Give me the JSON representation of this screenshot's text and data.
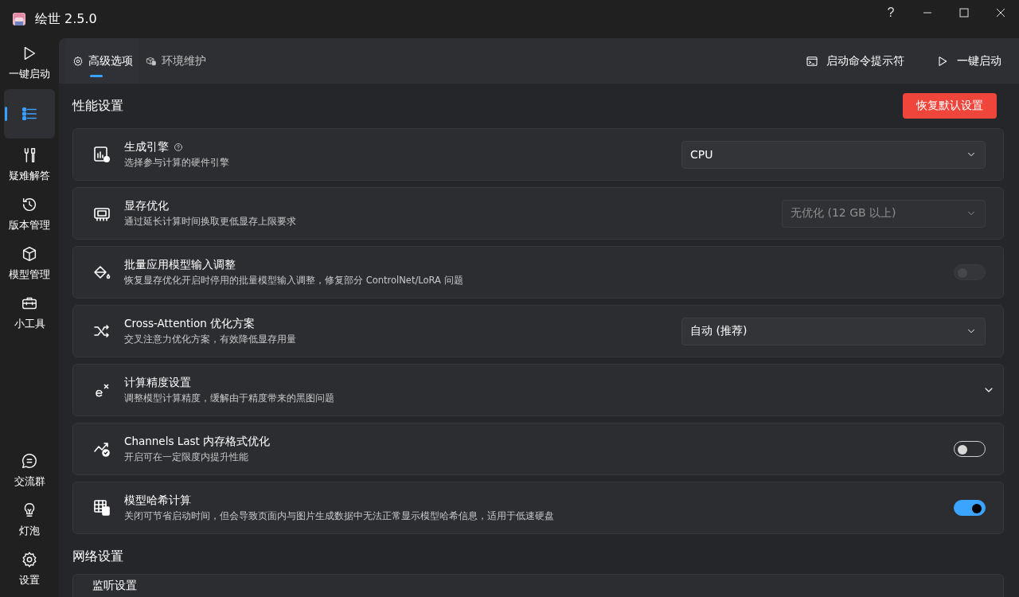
{
  "window": {
    "title": "绘世 2.5.0",
    "help_button": "?"
  },
  "sidebar": {
    "items": [
      {
        "label": "一键启动",
        "selected": false
      },
      {
        "selected": true
      },
      {
        "label": "疑难解答",
        "selected": false
      },
      {
        "label": "版本管理",
        "selected": false
      },
      {
        "label": "模型管理",
        "selected": false
      },
      {
        "label": "小工具",
        "selected": false
      }
    ],
    "bottom_items": [
      {
        "label": "交流群",
        "selected": false
      },
      {
        "label": "灯泡",
        "selected": false
      },
      {
        "label": "设置",
        "selected": false
      }
    ]
  },
  "tabs": [
    {
      "label": "高级选项",
      "selected": true
    },
    {
      "label": "环境维护",
      "selected": false
    }
  ],
  "actions": [
    {
      "label": "启动命令提示符"
    },
    {
      "label": "一键启动"
    }
  ],
  "sections": [
    {
      "title": "性能设置",
      "button": "恢复默认设置",
      "cards": [
        {
          "kind": "dropdown",
          "title": "生成引擎",
          "help_icon": true,
          "description": "选择参与计算的硬件引擎",
          "value": "CPU",
          "disabled": false
        },
        {
          "kind": "dropdown",
          "title": "显存优化",
          "description": "通过延长计算时间换取更低显存上限要求",
          "value": "无优化 (12 GB 以上)",
          "disabled": true
        },
        {
          "kind": "toggle",
          "title": "批量应用模型输入调整",
          "description": "恢复显存优化开启时停用的批量模型输入调整，修复部分 ControlNet/LoRA 问题",
          "on": false,
          "disabled": true
        },
        {
          "kind": "dropdown",
          "title": "Cross-Attention 优化方案",
          "description": "交叉注意力优化方案，有效降低显存用量",
          "value": "自动 (推荐)",
          "disabled": false
        },
        {
          "kind": "expander",
          "title": "计算精度设置",
          "description": "调整模型计算精度，缓解由于精度带来的黑图问题",
          "expanded": false
        },
        {
          "kind": "toggle",
          "title": "Channels Last 内存格式优化",
          "description": "开启可在一定限度内提升性能",
          "on": false,
          "disabled": false
        },
        {
          "kind": "toggle",
          "title": "模型哈希计算",
          "description": "关闭可节省启动时间，但会导致页面内与图片生成数据中无法正常显示模型哈希信息，适用于低速硬盘",
          "on": true,
          "disabled": false
        }
      ]
    },
    {
      "title": "网络设置",
      "cards": [
        {
          "kind": "plain",
          "title": "监听设置"
        }
      ]
    }
  ]
}
